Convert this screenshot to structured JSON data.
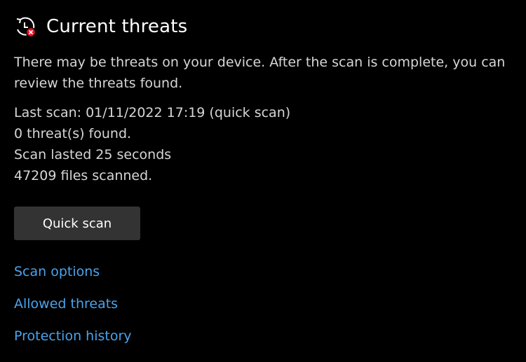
{
  "header": {
    "title": "Current threats",
    "icon": "history-clock-error-icon"
  },
  "description": "There may be threats on your device. After the scan is complete, you can review the threats found.",
  "scan_info": {
    "last_scan": "Last scan: 01/11/2022 17:19 (quick scan)",
    "threats_found": "0 threat(s) found.",
    "duration": "Scan lasted 25 seconds",
    "files_scanned": "47209 files scanned."
  },
  "quick_scan_button": {
    "label": "Quick scan"
  },
  "links": {
    "scan_options": "Scan options",
    "allowed_threats": "Allowed threats",
    "protection_history": "Protection history"
  },
  "colors": {
    "background": "#000000",
    "title_text": "#ffffff",
    "body_text": "#d6d6d6",
    "link": "#4aa3ec",
    "button_background": "#333333",
    "error_badge": "#e81123"
  }
}
